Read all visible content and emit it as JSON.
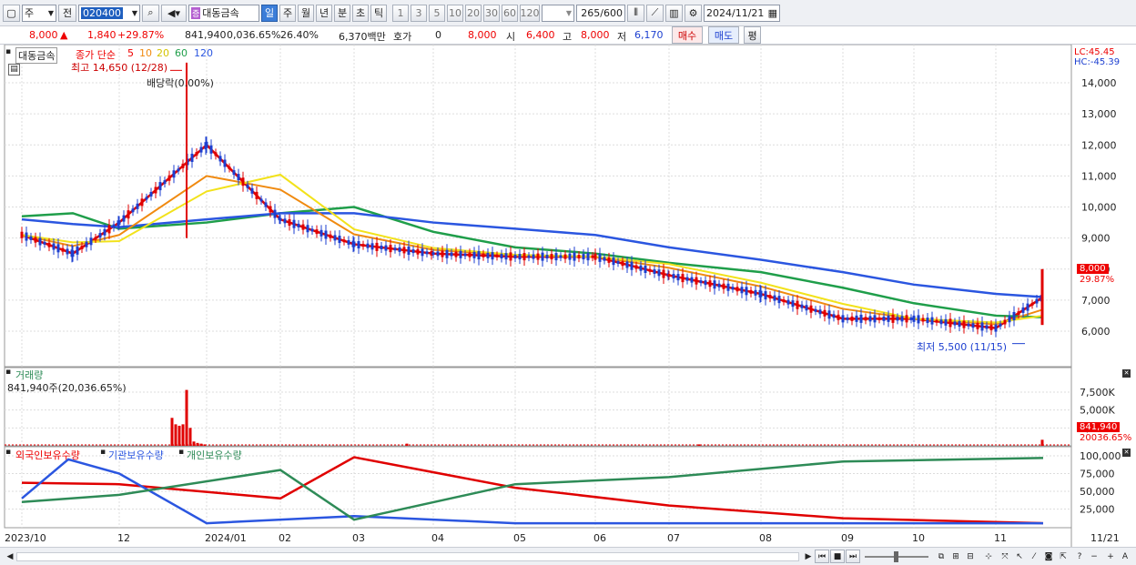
{
  "toolbar": {
    "period_type": "주",
    "prev_label": "전",
    "stock_code": "020400",
    "stock_name": "대동금속",
    "periods": [
      "일",
      "주",
      "월",
      "년",
      "분",
      "초",
      "틱"
    ],
    "active_period": "일",
    "intervals": [
      "1",
      "3",
      "5",
      "10",
      "20",
      "30",
      "60",
      "120"
    ],
    "count": "265",
    "count_total": "/600",
    "date": "2024/11/21"
  },
  "price_bar": {
    "price": "8,000",
    "change": "1,840",
    "change_rate": "+29.87%",
    "volume": "841,940",
    "vol_ratio": "0,036.65%",
    "turnover": "26.40%",
    "amount": "6,370백만",
    "quote_label": "호가",
    "quote": "0",
    "quote_price": "8,000",
    "open_label": "시",
    "open": "6,400",
    "high_label": "고",
    "high": "8,000",
    "low_label": "저",
    "low": "6,170",
    "buy_label": "매수",
    "sell_label": "매도",
    "eval_label": "평"
  },
  "legend": {
    "name": "대동금속",
    "ma_label": "종가 단순",
    "ma5": "5",
    "ma10": "10",
    "ma20": "20",
    "ma60": "60",
    "ma120": "120"
  },
  "annotations": {
    "high": "최고 14,650 (12/28)",
    "low": "최저 5,500 (11/15)",
    "dividend": "배당락(0.00%)",
    "lc": "LC:45.45",
    "hc": "HC:-45.39",
    "last_price": "8,000",
    "last_rate": "29.87%"
  },
  "volume_panel": {
    "title": "거래량",
    "info": "841,940주(20,036.65%)",
    "last": "841,940",
    "last_ratio": "20036.65%"
  },
  "holding_panel": {
    "foreign": "외국인보유수량",
    "institution": "기관보유수량",
    "individual": "개인보유수량"
  },
  "colors": {
    "up": "#e00000",
    "down": "#1c3fd0",
    "ma5": "#e00000",
    "ma10": "#f08a10",
    "ma20": "#f2e21b",
    "ma60": "#1f9e4a",
    "ma120": "#2b56e0",
    "foreign": "#e00000",
    "institution": "#2b56e0",
    "individual": "#2e8b57"
  },
  "chart_data": [
    {
      "type": "line",
      "title": "대동금속",
      "y_axis_ticks": [
        "14,000",
        "13,000",
        "12,000",
        "11,000",
        "10,000",
        "9,000",
        "8,000",
        "7,000",
        "6,000"
      ],
      "ylim": [
        5500,
        14650
      ],
      "x_axis_ticks": [
        "2023/10",
        "12",
        "2024/01",
        "02",
        "03",
        "04",
        "05",
        "06",
        "07",
        "08",
        "09",
        "10",
        "11",
        "11/21"
      ],
      "series": [
        {
          "name": "5",
          "x": [
            "2023/10",
            "2023/11",
            "2023/12",
            "2024/01",
            "2024/02",
            "2024/03",
            "2024/04",
            "2024/05",
            "2024/06",
            "2024/07",
            "2024/08",
            "2024/09",
            "2024/10",
            "2024/11",
            "2024/11/21"
          ],
          "values": [
            9100,
            8500,
            9500,
            12000,
            9600,
            8800,
            8500,
            8400,
            8400,
            7800,
            7200,
            6400,
            6400,
            6100,
            7100
          ]
        },
        {
          "name": "60",
          "x": [
            "2023/10",
            "2023/11",
            "2023/12",
            "2024/01",
            "2024/02",
            "2024/03",
            "2024/04",
            "2024/05",
            "2024/06",
            "2024/07",
            "2024/08",
            "2024/09",
            "2024/10",
            "2024/11",
            "2024/11/21"
          ],
          "values": [
            9700,
            9800,
            9300,
            9500,
            9800,
            10000,
            9200,
            8700,
            8500,
            8200,
            7900,
            7400,
            6900,
            6500,
            6450
          ]
        },
        {
          "name": "120",
          "x": [
            "2023/10",
            "2023/11",
            "2023/12",
            "2024/01",
            "2024/02",
            "2024/03",
            "2024/04",
            "2024/05",
            "2024/06",
            "2024/07",
            "2024/08",
            "2024/09",
            "2024/10",
            "2024/11",
            "2024/11/21"
          ],
          "values": [
            9600,
            9450,
            9350,
            9600,
            9800,
            9800,
            9500,
            9300,
            9100,
            8700,
            8300,
            7900,
            7500,
            7200,
            7100
          ]
        }
      ]
    },
    {
      "type": "bar",
      "title": "거래량",
      "y_axis_ticks": [
        "7,500K",
        "5,000K",
        "2,500K"
      ],
      "series": [
        {
          "name": "거래량",
          "x": [
            "2023/12 late",
            "2023/12/28",
            "2024/11/21"
          ],
          "values": [
            3900,
            7800,
            842
          ]
        }
      ]
    },
    {
      "type": "line",
      "title": "보유수량",
      "y_axis_ticks": [
        "100,000",
        "75,000",
        "50,000",
        "25,000"
      ],
      "series": [
        {
          "name": "외국인보유수량",
          "x": [
            "2023/10",
            "2023/12",
            "2024/02",
            "2024/03",
            "2024/05",
            "2024/07",
            "2024/09",
            "2024/11"
          ],
          "values": [
            62000,
            60000,
            40000,
            98000,
            55000,
            30000,
            12000,
            5000
          ]
        },
        {
          "name": "기관보유수량",
          "x": [
            "2023/10",
            "2023/11",
            "2023/12",
            "2024/01",
            "2024/03",
            "2024/05",
            "2024/07",
            "2024/09",
            "2024/11"
          ],
          "values": [
            40000,
            95000,
            75000,
            5000,
            15000,
            5000,
            5000,
            5000,
            5000
          ]
        },
        {
          "name": "개인보유수량",
          "x": [
            "2023/10",
            "2023/12",
            "2024/02",
            "2024/03",
            "2024/05",
            "2024/07",
            "2024/09",
            "2024/11"
          ],
          "values": [
            35000,
            45000,
            80000,
            10000,
            60000,
            70000,
            92000,
            97000
          ]
        }
      ]
    }
  ]
}
